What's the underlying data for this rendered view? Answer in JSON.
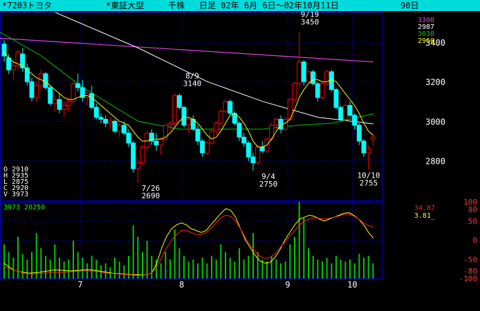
{
  "title_bar": {
    "ticker": "*7203トヨタ",
    "market": "*東証大型",
    "unit": "千株",
    "period": "日足 02年 6月 6日～02年10月11日",
    "count": "90日"
  },
  "colors": {
    "title_bar": "#00dcdc",
    "background": "#000000",
    "grid": "#0000c8",
    "candle_up": "#ff0000",
    "candle_down": "#00ffff",
    "ma_short": "#ffff00",
    "ma_mid": "#00c800",
    "ma_long_white": "#ffffff",
    "ma_long_magenta": "#e040e0",
    "volume": "#00c800",
    "osc_yellow": "#ffff00",
    "osc_red": "#ff2020"
  },
  "chart_data": [
    {
      "type": "candlestick",
      "ylim": [
        2600,
        3550
      ],
      "yticks": [
        "3400",
        "3200",
        "3000",
        "2800"
      ],
      "xticks": [
        "7",
        "8",
        "9",
        "10"
      ],
      "ma_legend": [
        {
          "label": "3300",
          "color": "#e040e0"
        },
        {
          "label": "2987",
          "color": "#ffffff"
        },
        {
          "label": "3038",
          "color": "#00c800"
        },
        {
          "label": "2960_",
          "color": "#ffff00"
        }
      ],
      "ohlc_readout": [
        "O 2910",
        "H 2935",
        "L 2875",
        "C 2920",
        "V 3973"
      ],
      "annotations": [
        {
          "index": 3,
          "label": "8/9",
          "value": "3140",
          "position": "above"
        },
        {
          "index": 5,
          "label": "7/26",
          "value": "2690",
          "position": "below"
        },
        {
          "index": 7,
          "label": "9/19",
          "value": "3450",
          "position": "above"
        },
        {
          "index": 6,
          "label": "9/4",
          "value": "2750",
          "position": "below"
        },
        {
          "index": 87,
          "label": "10/10",
          "value": "2755",
          "position": "below"
        }
      ],
      "candles": [
        [
          3390,
          3410,
          3300,
          3330
        ],
        [
          3320,
          3340,
          3240,
          3260
        ],
        [
          3260,
          3300,
          3210,
          3280
        ],
        [
          3280,
          3360,
          3260,
          3350
        ],
        [
          3340,
          3370,
          3250,
          3270
        ],
        [
          3270,
          3290,
          3180,
          3200
        ],
        [
          3200,
          3220,
          3100,
          3120
        ],
        [
          3120,
          3200,
          3100,
          3180
        ],
        [
          3180,
          3260,
          3160,
          3240
        ],
        [
          3240,
          3250,
          3160,
          3170
        ],
        [
          3170,
          3180,
          3080,
          3090
        ],
        [
          3090,
          3130,
          3050,
          3110
        ],
        [
          3110,
          3140,
          3040,
          3060
        ],
        [
          3060,
          3100,
          3020,
          3080
        ],
        [
          3080,
          3120,
          3050,
          3100
        ],
        [
          3100,
          3200,
          3090,
          3190
        ],
        [
          3190,
          3240,
          3150,
          3170
        ],
        [
          3170,
          3210,
          3100,
          3120
        ],
        [
          3120,
          3160,
          3080,
          3140
        ],
        [
          3140,
          3180,
          3060,
          3070
        ],
        [
          3070,
          3090,
          3010,
          3020
        ],
        [
          3020,
          3040,
          2990,
          3010
        ],
        [
          3010,
          3030,
          2970,
          2990
        ],
        [
          2990,
          3020,
          2960,
          3000
        ],
        [
          3000,
          3010,
          2940,
          2950
        ],
        [
          2950,
          2990,
          2920,
          2980
        ],
        [
          2980,
          3000,
          2930,
          2940
        ],
        [
          2940,
          2960,
          2870,
          2890
        ],
        [
          2890,
          2900,
          2740,
          2760
        ],
        [
          2760,
          2810,
          2690,
          2790
        ],
        [
          2790,
          2880,
          2780,
          2870
        ],
        [
          2870,
          2950,
          2850,
          2940
        ],
        [
          2940,
          2960,
          2880,
          2900
        ],
        [
          2900,
          2940,
          2850,
          2880
        ],
        [
          2880,
          2920,
          2830,
          2910
        ],
        [
          2910,
          2990,
          2900,
          2980
        ],
        [
          2980,
          3000,
          2950,
          2990
        ],
        [
          2990,
          3140,
          2980,
          3130
        ],
        [
          3130,
          3140,
          3060,
          3070
        ],
        [
          3070,
          3080,
          2970,
          2980
        ],
        [
          2980,
          3020,
          2940,
          3010
        ],
        [
          3010,
          3030,
          2950,
          2960
        ],
        [
          2960,
          2980,
          2880,
          2900
        ],
        [
          2900,
          2910,
          2820,
          2840
        ],
        [
          2840,
          2900,
          2830,
          2890
        ],
        [
          2890,
          2960,
          2880,
          2950
        ],
        [
          2950,
          3000,
          2930,
          2990
        ],
        [
          2990,
          3060,
          2980,
          3050
        ],
        [
          3050,
          3110,
          3040,
          3100
        ],
        [
          3100,
          3110,
          3030,
          3040
        ],
        [
          3040,
          3050,
          2980,
          2990
        ],
        [
          2990,
          3000,
          2900,
          2920
        ],
        [
          2920,
          2940,
          2870,
          2890
        ],
        [
          2890,
          2900,
          2800,
          2820
        ],
        [
          2820,
          2840,
          2750,
          2790
        ],
        [
          2790,
          2880,
          2780,
          2870
        ],
        [
          2870,
          2900,
          2840,
          2850
        ],
        [
          2850,
          2920,
          2840,
          2910
        ],
        [
          2910,
          2990,
          2900,
          2980
        ],
        [
          2980,
          3020,
          2960,
          3010
        ],
        [
          3010,
          3030,
          2940,
          2960
        ],
        [
          2960,
          3020,
          2950,
          3010
        ],
        [
          3010,
          3120,
          3000,
          3110
        ],
        [
          3110,
          3200,
          3100,
          3190
        ],
        [
          3190,
          3450,
          3180,
          3300
        ],
        [
          3300,
          3310,
          3180,
          3200
        ],
        [
          3200,
          3260,
          3190,
          3250
        ],
        [
          3250,
          3260,
          3180,
          3190
        ],
        [
          3190,
          3200,
          3100,
          3120
        ],
        [
          3120,
          3200,
          3110,
          3190
        ],
        [
          3190,
          3260,
          3180,
          3250
        ],
        [
          3250,
          3260,
          3150,
          3160
        ],
        [
          3160,
          3170,
          3060,
          3070
        ],
        [
          3070,
          3080,
          3000,
          3010
        ],
        [
          3010,
          3090,
          3000,
          3080
        ],
        [
          3080,
          3100,
          3020,
          3030
        ],
        [
          3030,
          3040,
          2960,
          2980
        ],
        [
          2980,
          2990,
          2880,
          2900
        ],
        [
          2900,
          2910,
          2820,
          2840
        ],
        [
          2840,
          2880,
          2755,
          2860
        ],
        [
          2910,
          2935,
          2875,
          2920
        ]
      ],
      "ma_short": [
        3350,
        3320,
        3300,
        3290,
        3280,
        3260,
        3240,
        3220,
        3210,
        3200,
        3180,
        3160,
        3140,
        3120,
        3110,
        3110,
        3120,
        3130,
        3130,
        3120,
        3100,
        3080,
        3060,
        3040,
        3020,
        3000,
        2990,
        2980,
        2950,
        2920,
        2900,
        2900,
        2910,
        2910,
        2910,
        2920,
        2940,
        2970,
        3000,
        3020,
        3020,
        3010,
        2990,
        2960,
        2930,
        2910,
        2920,
        2950,
        2990,
        3030,
        3040,
        3020,
        2990,
        2950,
        2900,
        2870,
        2870,
        2880,
        2910,
        2950,
        2980,
        2990,
        3010,
        3060,
        3120,
        3160,
        3190,
        3210,
        3210,
        3200,
        3200,
        3210,
        3200,
        3170,
        3140,
        3110,
        3080,
        3040,
        2990,
        2950,
        2930
      ]
    },
    {
      "type": "bar",
      "title": "3973 20250",
      "ylim": [
        0,
        20250
      ],
      "values": [
        9000,
        7000,
        5500,
        11000,
        6500,
        5000,
        7000,
        12000,
        8000,
        6000,
        5000,
        9000,
        5500,
        4500,
        5000,
        10000,
        7000,
        5500,
        4000,
        6000,
        5000,
        3500,
        4000,
        3000,
        5500,
        4500,
        3500,
        6000,
        14000,
        11000,
        7000,
        10000,
        6000,
        5000,
        4000,
        7000,
        5000,
        13000,
        8000,
        6000,
        4500,
        5000,
        4000,
        5500,
        4000,
        6000,
        5000,
        9000,
        7000,
        5500,
        4500,
        8000,
        5000,
        6000,
        12000,
        7000,
        5000,
        4500,
        6000,
        5000,
        4000,
        4500,
        9000,
        11000,
        20250,
        16000,
        8000,
        6000,
        5000,
        4500,
        5500,
        4000,
        6000,
        5000,
        4500,
        5000,
        4000,
        6500,
        5500,
        6000,
        3973
      ]
    },
    {
      "type": "line",
      "ylim": [
        -100,
        100
      ],
      "yticks": [
        "100",
        "80",
        "50",
        "0",
        "-50",
        "-80",
        "-100"
      ],
      "readouts": [
        {
          "value": "34.87",
          "color": "#ff2020"
        },
        {
          "value": "3.81_",
          "color": "#ffff00"
        }
      ],
      "series": [
        {
          "color": "#ffff00",
          "values": [
            -60,
            -70,
            -78,
            -82,
            -84,
            -86,
            -85,
            -84,
            -82,
            -80,
            -78,
            -78,
            -79,
            -80,
            -80,
            -79,
            -78,
            -77,
            -78,
            -80,
            -82,
            -84,
            -86,
            -87,
            -88,
            -89,
            -90,
            -90,
            -91,
            -90,
            -85,
            -60,
            -20,
            10,
            30,
            40,
            45,
            40,
            30,
            25,
            20,
            25,
            40,
            55,
            70,
            82,
            78,
            60,
            30,
            0,
            -20,
            -40,
            -55,
            -60,
            -58,
            -45,
            -25,
            0,
            20,
            40,
            55,
            60,
            65,
            62,
            55,
            50,
            55,
            60,
            65,
            70,
            72,
            65,
            55,
            40,
            20,
            5
          ]
        },
        {
          "color": "#ff2020",
          "values": [
            -70,
            -74,
            -78,
            -82,
            -86,
            -88,
            -88,
            -87,
            -86,
            -85,
            -84,
            -84,
            -84,
            -83,
            -82,
            -81,
            -80,
            -80,
            -81,
            -82,
            -84,
            -86,
            -87,
            -88,
            -89,
            -90,
            -91,
            -92,
            -92,
            -90,
            -85,
            -70,
            -45,
            -20,
            0,
            15,
            25,
            25,
            20,
            15,
            15,
            20,
            30,
            45,
            58,
            65,
            62,
            50,
            30,
            5,
            -15,
            -30,
            -42,
            -48,
            -45,
            -35,
            -20,
            -5,
            10,
            25,
            40,
            50,
            55,
            58,
            57,
            55,
            57,
            60,
            63,
            67,
            68,
            63,
            55,
            45,
            38,
            34.87
          ]
        }
      ]
    }
  ]
}
